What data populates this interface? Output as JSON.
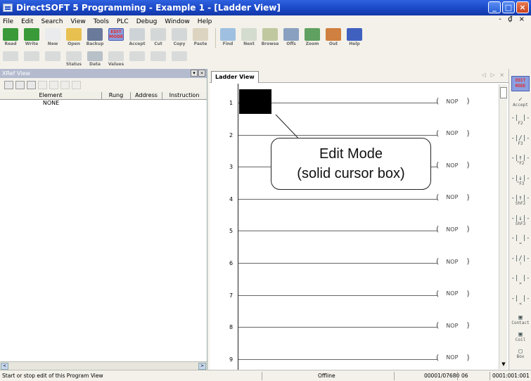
{
  "window": {
    "title": "DirectSOFT 5 Programming - Example 1 - [Ladder View]",
    "min": "_",
    "max": "□",
    "close": "×"
  },
  "menu": [
    "File",
    "Edit",
    "Search",
    "View",
    "Tools",
    "PLC",
    "Debug",
    "Window",
    "Help"
  ],
  "mdi_controls": "- ₫ ×",
  "toolbar1": [
    {
      "label": "Read",
      "color": "#3a9a3a",
      "disabled": false
    },
    {
      "label": "Write",
      "color": "#3a9a3a",
      "disabled": false
    },
    {
      "label": "New",
      "color": "#dde4f0",
      "disabled": true
    },
    {
      "label": "Open",
      "color": "#e8c050",
      "disabled": false
    },
    {
      "label": "Backup",
      "color": "#6a7a9a",
      "disabled": false
    },
    {
      "label": "Accept",
      "color": "#a0b0c0",
      "disabled": true
    },
    {
      "label": "Cut",
      "color": "#b0b8c0",
      "disabled": true
    },
    {
      "label": "Copy",
      "color": "#b0b8c0",
      "disabled": true
    },
    {
      "label": "Paste",
      "color": "#c0b090",
      "disabled": true
    },
    {
      "label": "Find",
      "color": "#9fc0e0",
      "disabled": false
    },
    {
      "label": "Next",
      "color": "#b0c0b0",
      "disabled": true
    },
    {
      "label": "Browse",
      "color": "#c0c8a0",
      "disabled": false
    },
    {
      "label": "Offs",
      "color": "#8aa0c0",
      "disabled": false
    },
    {
      "label": "Zoom",
      "color": "#60a060",
      "disabled": false
    },
    {
      "label": "Out",
      "color": "#d08040",
      "disabled": false
    },
    {
      "label": "Help",
      "color": "#4060c0",
      "disabled": false
    }
  ],
  "edit_mode_button": {
    "line1": "EDIT",
    "line2": "MODE"
  },
  "toolbar2": [
    {
      "label": "",
      "disabled": true
    },
    {
      "label": "",
      "disabled": true
    },
    {
      "label": "",
      "disabled": true
    },
    {
      "label": "Status",
      "disabled": true
    },
    {
      "label": "Data",
      "disabled": false
    },
    {
      "label": "Values",
      "disabled": true
    },
    {
      "label": "",
      "disabled": true
    },
    {
      "label": "",
      "disabled": true
    },
    {
      "label": "",
      "disabled": true
    }
  ],
  "xref": {
    "title": "XRef View",
    "header_buttons": [
      "▾",
      "×"
    ],
    "columns": [
      "Element",
      "Rung",
      "Address",
      "Instruction"
    ],
    "rows": [
      {
        "element": "NONE",
        "rung": "",
        "address": "",
        "instruction": ""
      }
    ],
    "scroll_left": "<",
    "scroll_right": ">"
  },
  "ladder": {
    "tab": "Ladder View",
    "tab_controls": "◁ ▷ ×",
    "rungs": [
      {
        "num": "1",
        "instr": "NOP"
      },
      {
        "num": "2",
        "instr": "NOP"
      },
      {
        "num": "3",
        "instr": "NOP"
      },
      {
        "num": "4",
        "instr": "NOP"
      },
      {
        "num": "5",
        "instr": "NOP"
      },
      {
        "num": "6",
        "instr": "NOP"
      },
      {
        "num": "7",
        "instr": "NOP"
      },
      {
        "num": "8",
        "instr": "NOP"
      },
      {
        "num": "9",
        "instr": "NOP"
      }
    ],
    "coil_left": "(",
    "coil_right": ")"
  },
  "callout": {
    "line1": "Edit Mode",
    "line2": "(solid cursor box)"
  },
  "palette": {
    "edit_mode": {
      "line1": "EDIT",
      "line2": "MODE"
    },
    "accept": "Accept",
    "items": [
      {
        "sym": "-| |-",
        "key": "F2"
      },
      {
        "sym": "-|/|-",
        "key": "F3"
      },
      {
        "sym": "-|↑|-",
        "key": "^F2"
      },
      {
        "sym": "-|↓|-",
        "key": "^F3"
      },
      {
        "sym": "-|↑|-",
        "key": "ShF2"
      },
      {
        "sym": "-|↓|-",
        "key": "ShF3"
      },
      {
        "sym": "-| |-",
        "key": "="
      },
      {
        "sym": "-|/|-",
        "key": "!"
      },
      {
        "sym": "-| |-",
        "key": ">"
      },
      {
        "sym": "-| |-",
        "key": "<"
      }
    ],
    "contact": "Contact",
    "coil": "Coil",
    "box": "Box"
  },
  "status": {
    "message": "Start or stop edit of this Program View",
    "mode": "Offline",
    "memory": "00001/07680",
    "cpu": "06",
    "position": "0001:001:001"
  }
}
